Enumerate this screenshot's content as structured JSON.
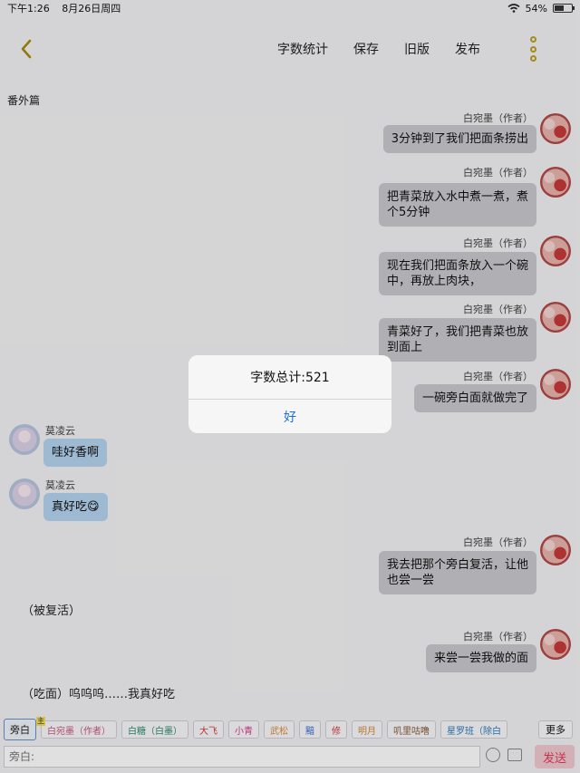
{
  "status": {
    "time": "下午1:26",
    "date": "8月26日周四",
    "battery": "54%",
    "battery_level": 0.54
  },
  "nav": {
    "word_count": "字数统计",
    "save": "保存",
    "old_version": "旧版",
    "publish": "发布"
  },
  "section_title": "番外篇",
  "messages": [
    {
      "side": "right",
      "name": "白宛墨（作者）",
      "text": "3分钟到了我们把面条捞出"
    },
    {
      "side": "right",
      "name": "白宛墨（作者）",
      "text": "把青菜放入水中煮一煮，煮\n个5分钟"
    },
    {
      "side": "right",
      "name": "白宛墨（作者）",
      "text": "现在我们把面条放入一个碗\n中，再放上肉块，"
    },
    {
      "side": "right",
      "name": "白宛墨（作者）",
      "text": "青菜好了，我们把青菜也放\n到面上"
    },
    {
      "side": "right",
      "name": "白宛墨（作者）",
      "text": "一碗旁白面就做完了"
    },
    {
      "side": "left",
      "name": "莫凌云",
      "text": "哇好香啊"
    },
    {
      "side": "left",
      "name": "莫凌云",
      "text": "真好吃😋"
    },
    {
      "side": "right",
      "name": "白宛墨（作者）",
      "text": "我去把那个旁白复活，让他\n也尝一尝"
    },
    {
      "side": "narration",
      "text": "（被复活）"
    },
    {
      "side": "right",
      "name": "白宛墨（作者）",
      "text": "来尝一尝我做的面"
    },
    {
      "side": "narration",
      "text": "（吃面）呜呜呜……我真好吃"
    }
  ],
  "alert": {
    "title": "字数总计:521",
    "ok": "好"
  },
  "roles": [
    {
      "label": "旁白",
      "color": "#222222",
      "active": true
    },
    {
      "label": "白宛墨（作者）",
      "color": "#c6587a",
      "badge": "主"
    },
    {
      "label": "白糖（白墨）",
      "color": "#2e8a6a"
    },
    {
      "label": "大飞",
      "color": "#d33a3a"
    },
    {
      "label": "小青",
      "color": "#d33a8a"
    },
    {
      "label": "武松",
      "color": "#d98a3a"
    },
    {
      "label": "黯",
      "color": "#3a6ad3"
    },
    {
      "label": "修",
      "color": "#d33a3a"
    },
    {
      "label": "明月",
      "color": "#d3863a"
    },
    {
      "label": "叽里咕噜",
      "color": "#8a5a3a"
    },
    {
      "label": "星罗班（除白",
      "color": "#2e7ab8"
    }
  ],
  "more": "更多",
  "input": {
    "placeholder": "旁白:"
  },
  "send": "发送"
}
